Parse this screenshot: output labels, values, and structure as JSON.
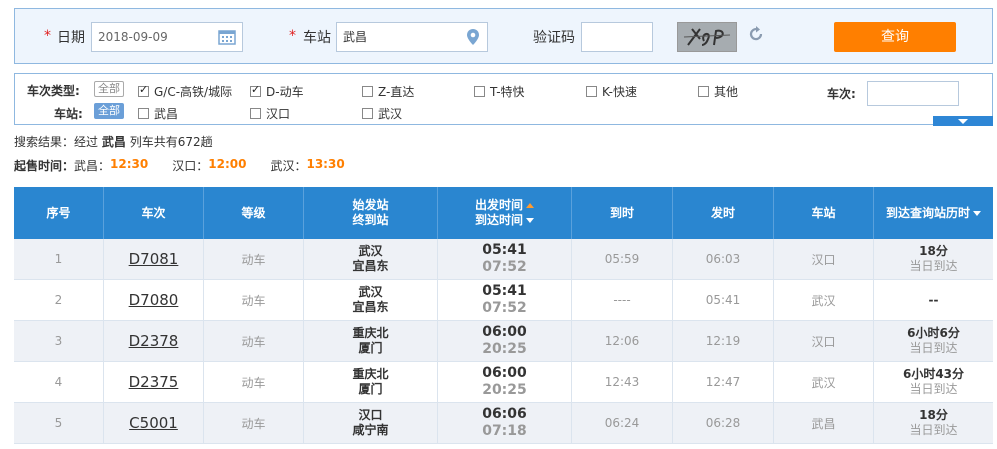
{
  "search": {
    "date_label": "日期",
    "date_value": "2018-09-09",
    "station_label": "车站",
    "station_value": "武昌",
    "captcha_label": "验证码",
    "captcha_value": "",
    "captcha_image_text": "Y9P",
    "query_button": "查询",
    "required_mark": "*"
  },
  "filters": {
    "type_label": "车次类型:",
    "station_label": "车站:",
    "all_label": "全部",
    "train_no_label": "车次:",
    "types": [
      {
        "label": "G/C-高铁/城际",
        "checked": true
      },
      {
        "label": "D-动车",
        "checked": true
      },
      {
        "label": "Z-直达",
        "checked": false
      },
      {
        "label": "T-特快",
        "checked": false
      },
      {
        "label": "K-快速",
        "checked": false
      },
      {
        "label": "其他",
        "checked": false
      }
    ],
    "stations": [
      {
        "label": "武昌",
        "checked": false
      },
      {
        "label": "汉口",
        "checked": false
      },
      {
        "label": "武汉",
        "checked": false
      }
    ]
  },
  "result": {
    "prefix": "搜索结果：经过",
    "station": "武昌",
    "suffix": "列车共有672趟"
  },
  "sale": {
    "label": "起售时间：",
    "items": [
      {
        "station": "武昌：",
        "time": "12:30"
      },
      {
        "station": "汉口：",
        "time": "12:00"
      },
      {
        "station": "武汉：",
        "time": "13:30"
      }
    ]
  },
  "table": {
    "headers": {
      "index": "序号",
      "train": "车次",
      "grade": "等级",
      "from_station": "始发站",
      "to_station": "终到站",
      "depart_time": "出发时间",
      "arrive_time": "到达时间",
      "arrive": "到时",
      "leave": "发时",
      "station": "车站",
      "duration": "到达查询站历时"
    },
    "rows": [
      {
        "index": "1",
        "train": "D7081",
        "grade": "动车",
        "from": "武汉",
        "to": "宜昌东",
        "dep": "05:41",
        "arr": "07:52",
        "arrive": "05:59",
        "leave": "06:03",
        "station": "汉口",
        "dur": "18分",
        "dur_sub": "当日到达"
      },
      {
        "index": "2",
        "train": "D7080",
        "grade": "动车",
        "from": "武汉",
        "to": "宜昌东",
        "dep": "05:41",
        "arr": "07:52",
        "arrive": "----",
        "leave": "05:41",
        "station": "武汉",
        "dur": "--",
        "dur_sub": ""
      },
      {
        "index": "3",
        "train": "D2378",
        "grade": "动车",
        "from": "重庆北",
        "to": "厦门",
        "dep": "06:00",
        "arr": "20:25",
        "arrive": "12:06",
        "leave": "12:19",
        "station": "汉口",
        "dur": "6小时6分",
        "dur_sub": "当日到达"
      },
      {
        "index": "4",
        "train": "D2375",
        "grade": "动车",
        "from": "重庆北",
        "to": "厦门",
        "dep": "06:00",
        "arr": "20:25",
        "arrive": "12:43",
        "leave": "12:47",
        "station": "武汉",
        "dur": "6小时43分",
        "dur_sub": "当日到达"
      },
      {
        "index": "5",
        "train": "C5001",
        "grade": "动车",
        "from": "汉口",
        "to": "咸宁南",
        "dep": "06:06",
        "arr": "07:18",
        "arrive": "06:24",
        "leave": "06:28",
        "station": "武昌",
        "dur": "18分",
        "dur_sub": "当日到达"
      }
    ]
  }
}
